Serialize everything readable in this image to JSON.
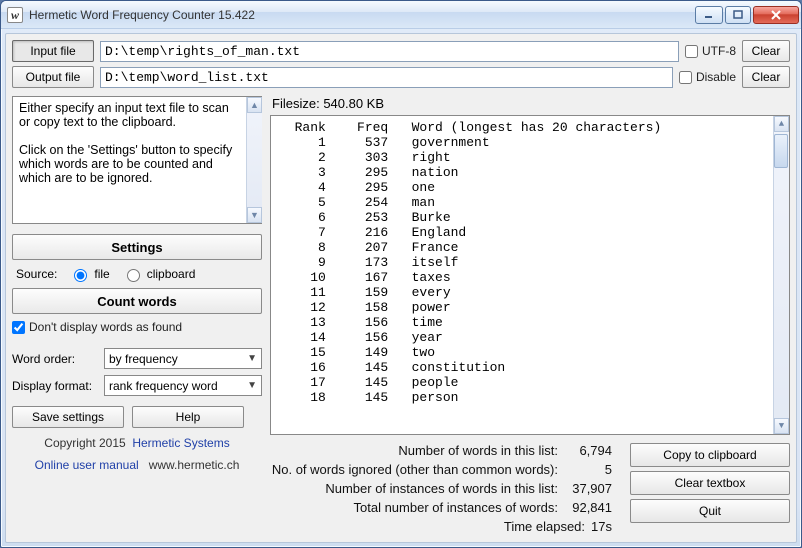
{
  "window": {
    "title": "Hermetic Word Frequency Counter 15.422"
  },
  "io": {
    "input_btn": "Input file",
    "output_btn": "Output file",
    "input_path": "D:\\temp\\rights_of_man.txt",
    "output_path": "D:\\temp\\word_list.txt",
    "utf8_label": "UTF-8",
    "disable_label": "Disable",
    "clear_btn": "Clear"
  },
  "help_text_1": "Either specify an input text file to scan or copy text to the clipboard.",
  "help_text_2": "Click on the 'Settings' button to specify which words are to be counted and which are to be ignored.",
  "left": {
    "settings_btn": "Settings",
    "source_label": "Source:",
    "src_file": "file",
    "src_clip": "clipboard",
    "count_btn": "Count words",
    "dont_display": "Don't display words as found",
    "order_label": "Word order:",
    "order_value": "by frequency",
    "format_label": "Display format:",
    "format_value": "rank frequency word",
    "save_btn": "Save settings",
    "help_btn": "Help",
    "copyright": "Copyright 2015",
    "hermetic_sys": "Hermetic Systems",
    "manual": "Online user manual",
    "site": "www.hermetic.ch"
  },
  "filesize_label": "Filesize:",
  "filesize_value": "540.80 KB",
  "list_header_prefix": "  Rank    Freq   Word (longest has 20 characters)",
  "words": [
    {
      "rank": 1,
      "freq": 537,
      "word": "government"
    },
    {
      "rank": 2,
      "freq": 303,
      "word": "right"
    },
    {
      "rank": 3,
      "freq": 295,
      "word": "nation"
    },
    {
      "rank": 4,
      "freq": 295,
      "word": "one"
    },
    {
      "rank": 5,
      "freq": 254,
      "word": "man"
    },
    {
      "rank": 6,
      "freq": 253,
      "word": "Burke"
    },
    {
      "rank": 7,
      "freq": 216,
      "word": "England"
    },
    {
      "rank": 8,
      "freq": 207,
      "word": "France"
    },
    {
      "rank": 9,
      "freq": 173,
      "word": "itself"
    },
    {
      "rank": 10,
      "freq": 167,
      "word": "taxes"
    },
    {
      "rank": 11,
      "freq": 159,
      "word": "every"
    },
    {
      "rank": 12,
      "freq": 158,
      "word": "power"
    },
    {
      "rank": 13,
      "freq": 156,
      "word": "time"
    },
    {
      "rank": 14,
      "freq": 156,
      "word": "year"
    },
    {
      "rank": 15,
      "freq": 149,
      "word": "two"
    },
    {
      "rank": 16,
      "freq": 145,
      "word": "constitution"
    },
    {
      "rank": 17,
      "freq": 145,
      "word": "people"
    },
    {
      "rank": 18,
      "freq": 145,
      "word": "person"
    }
  ],
  "stats": {
    "num_words_label": "Number of words in this list:",
    "num_words": "6,794",
    "ignored_label": "No. of words ignored (other than common words):",
    "ignored": "5",
    "instances_list_label": "Number of instances of words in this list:",
    "instances_list": "37,907",
    "total_inst_label": "Total number of instances of words:",
    "total_inst": "92,841",
    "elapsed_label": "Time elapsed:",
    "elapsed": "17s"
  },
  "actions": {
    "copy": "Copy to clipboard",
    "clear_tb": "Clear textbox",
    "quit": "Quit"
  }
}
